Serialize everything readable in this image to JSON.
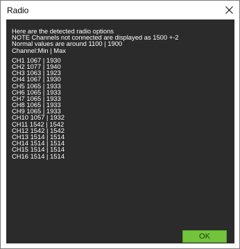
{
  "window": {
    "title": "Radio",
    "close_icon": "close-icon"
  },
  "content": {
    "intro_lines": [
      "Here are the detected radio options",
      "NOTE Channels not connected are displayed as 1500 +-2",
      "Normal values are around 1100 | 1900",
      "Channel:Min | Max"
    ],
    "channels": [
      "CH1 1067 | 1930",
      "CH2 1077 | 1940",
      "CH3 1063 | 1923",
      "CH4 1067 | 1930",
      "CH5 1065 | 1933",
      "CH6 1065 | 1933",
      "CH7 1065 | 1933",
      "CH8 1065 | 1933",
      "CH9 1065 | 1933",
      "CH10 1057 | 1932",
      "CH11 1542 | 1542",
      "CH12 1542 | 1542",
      "CH13 1514 | 1514",
      "CH14 1514 | 1514",
      "CH15 1514 | 1514",
      "CH16 1514 | 1514"
    ]
  },
  "buttons": {
    "ok_label": "OK"
  },
  "colors": {
    "client_background": "#2b2b2b",
    "text": "#ffffff",
    "ok_button": "#72c43c"
  }
}
